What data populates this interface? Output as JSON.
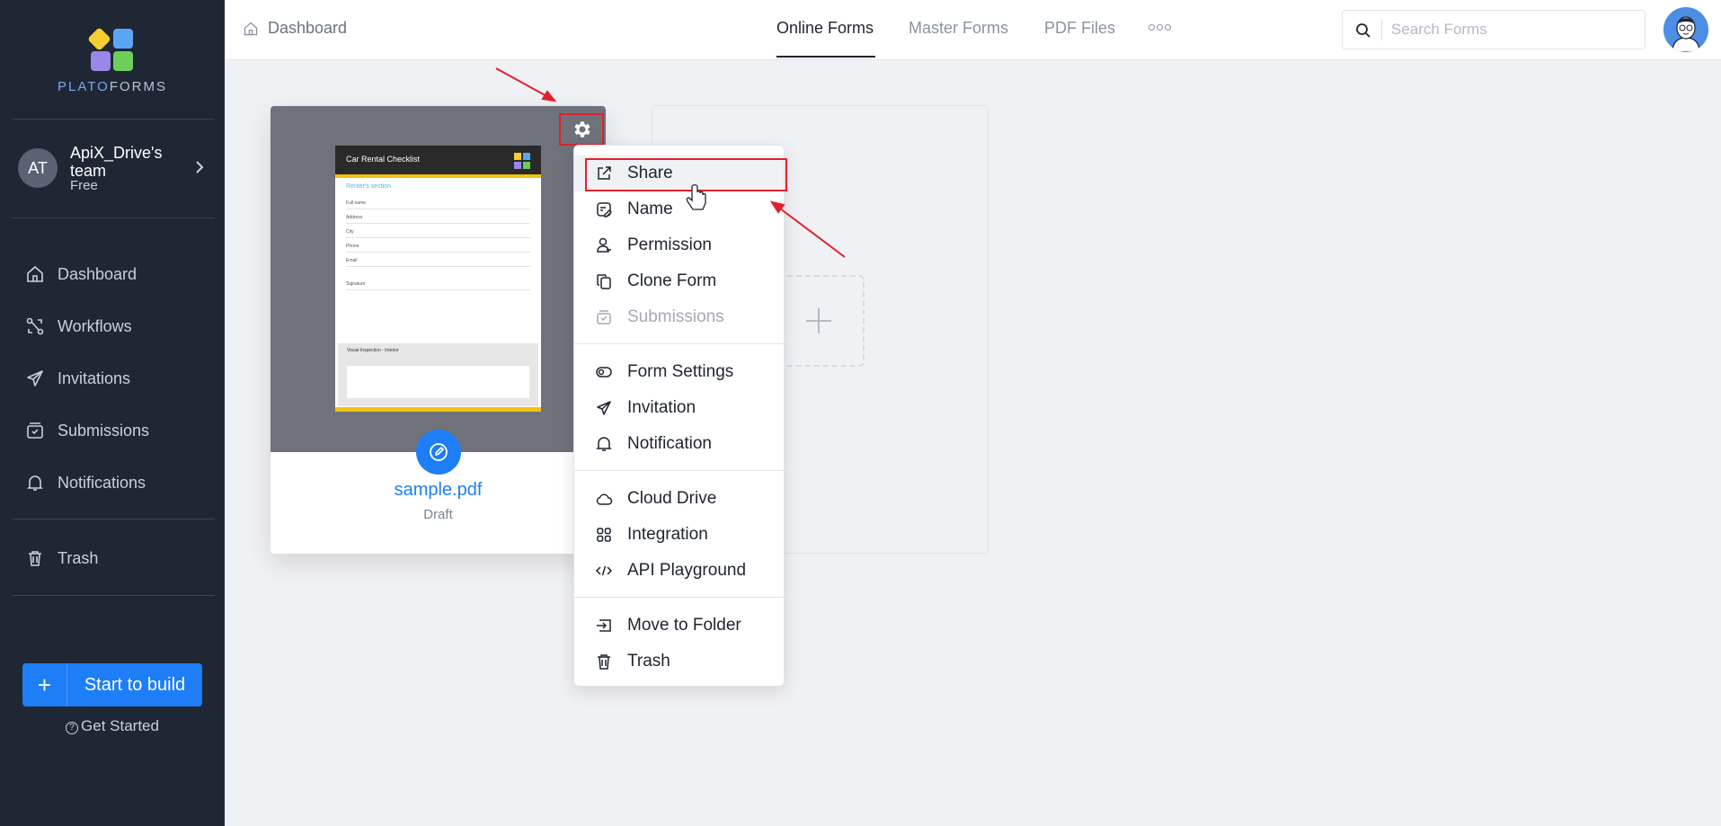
{
  "brand": {
    "logo_text_accent": "PLATO",
    "logo_text_rest": "FORMS"
  },
  "team": {
    "initials": "AT",
    "name": "ApiX_Drive's team",
    "plan": "Free"
  },
  "sidebar": {
    "items": [
      {
        "label": "Dashboard",
        "icon": "home-icon"
      },
      {
        "label": "Workflows",
        "icon": "workflow-icon"
      },
      {
        "label": "Invitations",
        "icon": "send-icon"
      },
      {
        "label": "Submissions",
        "icon": "inbox-icon"
      },
      {
        "label": "Notifications",
        "icon": "bell-icon"
      },
      {
        "label": "Trash",
        "icon": "trash-icon"
      }
    ],
    "build_label": "Start to build",
    "get_started": "Get Started"
  },
  "header": {
    "breadcrumb": "Dashboard",
    "tabs": [
      "Online Forms",
      "Master Forms",
      "PDF Files"
    ],
    "active_tab": "Online Forms",
    "search_placeholder": "Search Forms"
  },
  "card": {
    "title": "sample.pdf",
    "status": "Draft",
    "thumbnail": {
      "heading": "Car Rental Checklist",
      "section": "Renter's section",
      "rows": [
        "Full name",
        "Address",
        "City",
        "Phone",
        "Email",
        "Signature"
      ],
      "gray_heading": "Visual Inspection - Interior"
    }
  },
  "menu": {
    "items": [
      {
        "label": "Share",
        "icon": "share-icon",
        "state": "highlighted"
      },
      {
        "label": "Name",
        "icon": "rename-icon"
      },
      {
        "label": "Permission",
        "icon": "user-permission-icon"
      },
      {
        "label": "Clone Form",
        "icon": "clone-icon"
      },
      {
        "label": "Submissions",
        "icon": "inbox-icon",
        "state": "disabled"
      },
      {
        "label": "Form Settings",
        "icon": "toggle-icon"
      },
      {
        "label": "Invitation",
        "icon": "send-icon"
      },
      {
        "label": "Notification",
        "icon": "bell-icon"
      },
      {
        "label": "Cloud Drive",
        "icon": "cloud-icon"
      },
      {
        "label": "Integration",
        "icon": "grid-icon"
      },
      {
        "label": "API Playground",
        "icon": "code-icon"
      },
      {
        "label": "Move to Folder",
        "icon": "move-folder-icon"
      },
      {
        "label": "Trash",
        "icon": "trash-icon"
      }
    ]
  },
  "colors": {
    "accent": "#1e7ef7",
    "sidebar_bg": "#1f2735",
    "annotation": "#e0212d"
  }
}
